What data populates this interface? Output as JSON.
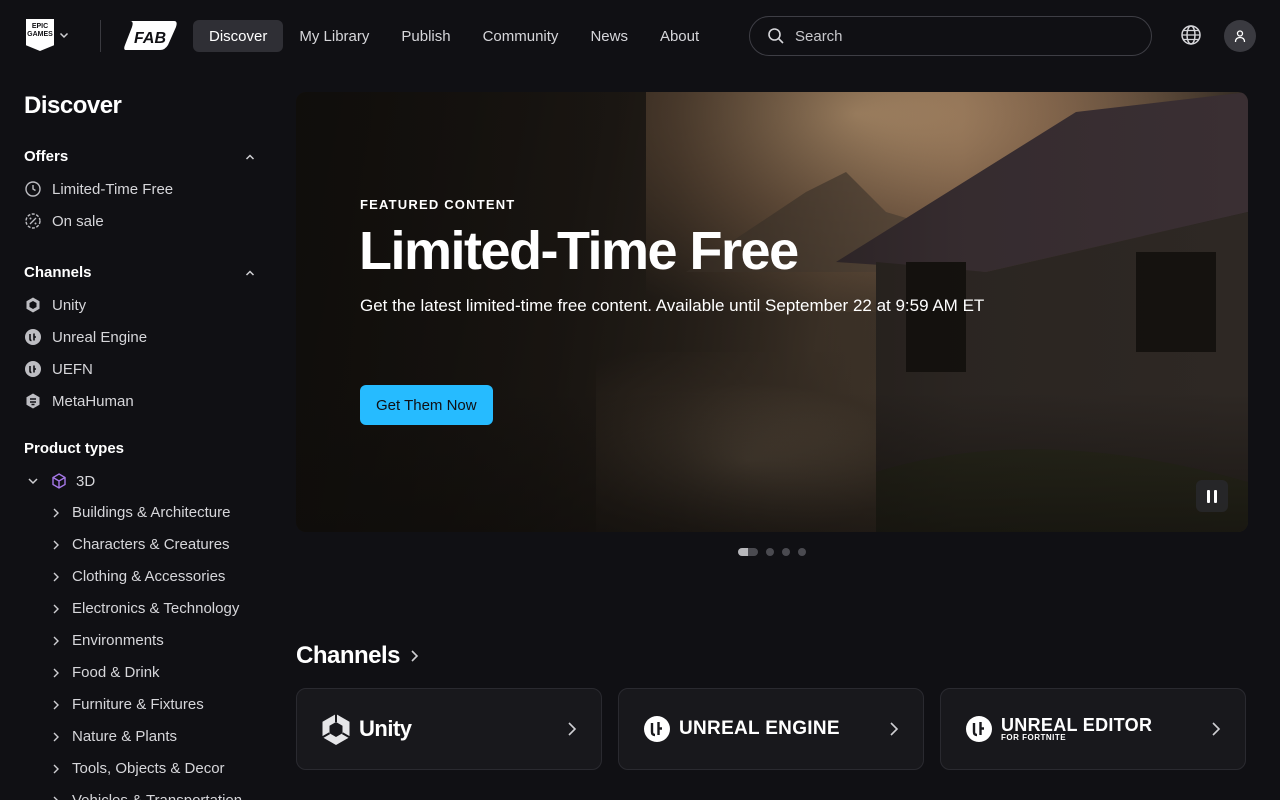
{
  "header": {
    "epic_logo_text": "EPIC GAMES",
    "fab_logo_text": "FAB",
    "nav": [
      {
        "label": "Discover",
        "active": true
      },
      {
        "label": "My Library",
        "active": false
      },
      {
        "label": "Publish",
        "active": false
      },
      {
        "label": "Community",
        "active": false
      },
      {
        "label": "News",
        "active": false
      },
      {
        "label": "About",
        "active": false
      }
    ],
    "search_placeholder": "Search"
  },
  "sidebar": {
    "title": "Discover",
    "offers": {
      "heading": "Offers",
      "items": [
        {
          "label": "Limited-Time Free",
          "icon": "clock-icon"
        },
        {
          "label": "On sale",
          "icon": "sale-badge-icon"
        }
      ]
    },
    "channels": {
      "heading": "Channels",
      "items": [
        {
          "label": "Unity",
          "icon": "unity-icon"
        },
        {
          "label": "Unreal Engine",
          "icon": "unreal-icon"
        },
        {
          "label": "UEFN",
          "icon": "uefn-icon"
        },
        {
          "label": "MetaHuman",
          "icon": "metahuman-icon"
        }
      ]
    },
    "product_types": {
      "heading": "Product types",
      "root": {
        "label": "3D",
        "icon": "cube-icon"
      },
      "items": [
        {
          "label": "Buildings & Architecture"
        },
        {
          "label": "Characters & Creatures"
        },
        {
          "label": "Clothing & Accessories"
        },
        {
          "label": "Electronics & Technology"
        },
        {
          "label": "Environments"
        },
        {
          "label": "Food & Drink"
        },
        {
          "label": "Furniture & Fixtures"
        },
        {
          "label": "Nature & Plants"
        },
        {
          "label": "Tools, Objects & Decor"
        },
        {
          "label": "Vehicles & Transportation"
        }
      ]
    }
  },
  "hero": {
    "eyebrow": "FEATURED CONTENT",
    "title": "Limited-Time Free",
    "description": "Get the latest limited-time free content. Available until September 22 at 9:59 AM ET",
    "cta": "Get Them Now",
    "slides_total": 4,
    "current_slide": 1
  },
  "channels_section": {
    "title": "Channels",
    "cards": [
      {
        "name": "Unity",
        "sub": ""
      },
      {
        "name": "UNREAL ENGINE",
        "sub": ""
      },
      {
        "name": "UNREAL EDITOR",
        "sub": "FOR FORTNITE"
      }
    ]
  },
  "colors": {
    "background": "#101014",
    "accent": "#26bbff",
    "nav_active": "#2f2f35"
  }
}
